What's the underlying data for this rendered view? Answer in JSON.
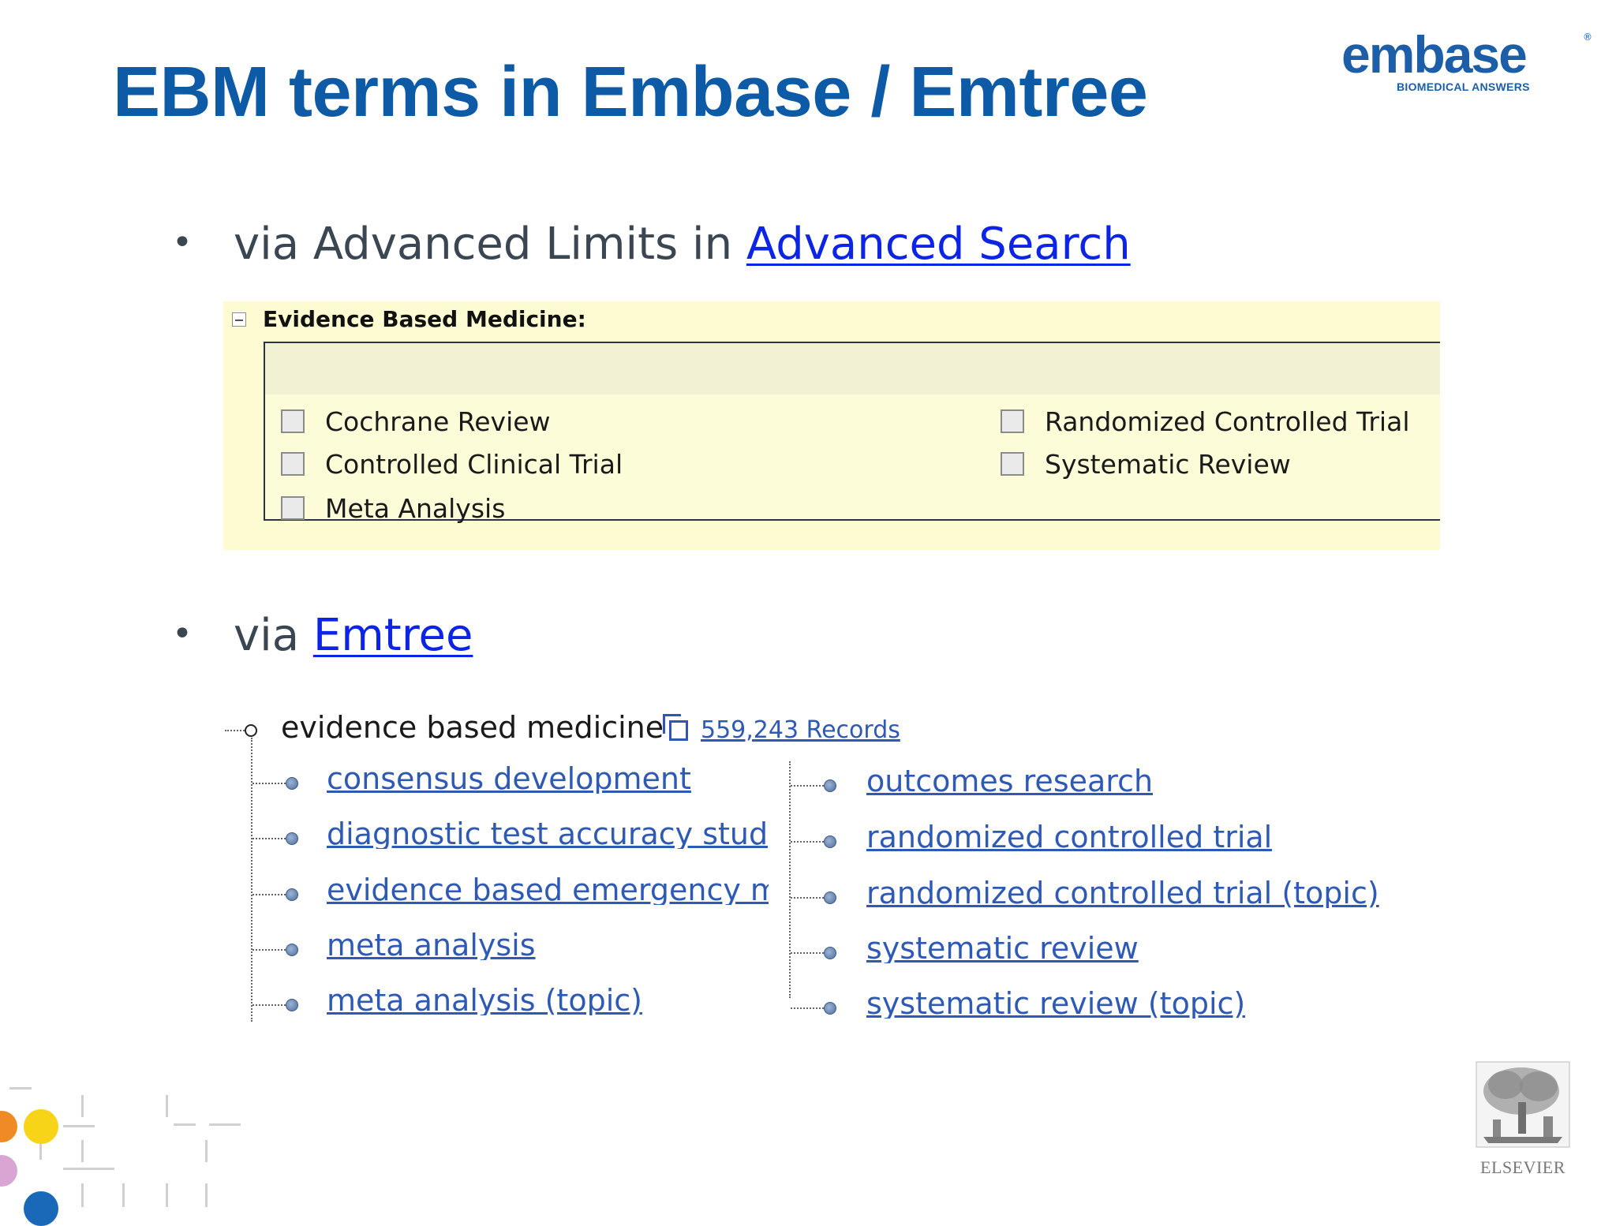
{
  "slide": {
    "title": "EBM terms in Embase / Emtree"
  },
  "logo": {
    "word": "embase",
    "registered": "®",
    "tagline": "BIOMEDICAL ANSWERS"
  },
  "bullets": [
    {
      "dot": "•",
      "prefix": "via Advanced Limits in ",
      "link": "Advanced Search"
    },
    {
      "dot": "•",
      "prefix": "via ",
      "link": "Emtree"
    }
  ],
  "ebm_panel": {
    "header": "Evidence Based Medicine:",
    "options": [
      "Cochrane Review",
      "Controlled Clinical Trial",
      "Meta Analysis",
      "Randomized Controlled Trial",
      "Systematic Review"
    ]
  },
  "emtree": {
    "root": "evidence based medicine",
    "records": "559,243 Records",
    "left_terms": [
      "consensus development",
      "diagnostic test accuracy stud",
      "evidence based emergency m",
      "meta analysis",
      "meta analysis (topic)"
    ],
    "right_terms": [
      "outcomes research",
      "randomized controlled trial",
      "randomized controlled trial (topic)",
      "systematic review",
      "systematic review (topic)"
    ]
  },
  "publisher": {
    "name": "ELSEVIER"
  },
  "colors": {
    "title": "#0d5aa7",
    "link": "#0b24e6",
    "tree_link": "#2e5ab5",
    "panel_bg": "#fdfbd2",
    "deco_orange": "#f08a24",
    "deco_yellow": "#f7d417",
    "deco_pink": "#d9a6d3",
    "deco_blue": "#1a68b8"
  }
}
